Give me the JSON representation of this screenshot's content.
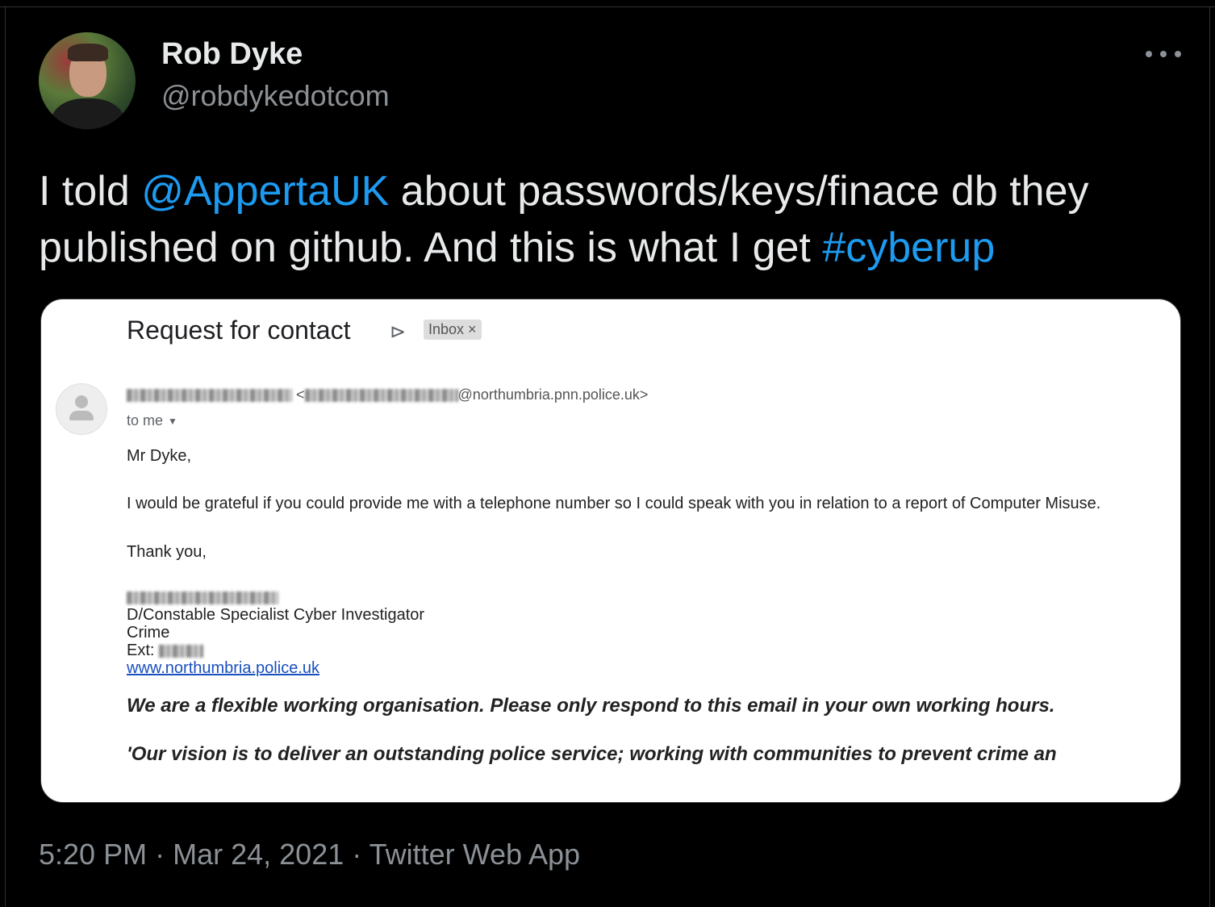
{
  "tweet": {
    "display_name": "Rob Dyke",
    "handle": "@robdykedotcom",
    "text_before_mention": "I told ",
    "mention": "@AppertaUK",
    "text_after_mention": " about passwords/keys/finace db they published on github. And this is what I get ",
    "hashtag": "#cyberup",
    "time": "5:20 PM",
    "date": "Mar 24, 2021",
    "source": "Twitter Web App",
    "separator": "·",
    "link_color": "#1d9bf0"
  },
  "email": {
    "subject": "Request for contact",
    "label_chip": "Inbox ×",
    "sender_domain": "@northumbria.pnn.police.uk>",
    "sender_lt": "<",
    "to": "to me",
    "greeting": "Mr Dyke,",
    "body": "I would be grateful if you could provide me with a telephone number so I could speak with you in relation to a report of Computer Misuse.",
    "thanks": "Thank you,",
    "signature_title": "D/Constable Specialist Cyber Investigator",
    "signature_dept": "Crime",
    "signature_ext_label": "Ext:",
    "signature_link": "www.northumbria.police.uk",
    "footer_1": "We are a flexible working organisation. Please only respond to this email in your own working hours.",
    "footer_2": "'Our vision is to deliver an outstanding police service; working with communities to prevent crime an"
  }
}
